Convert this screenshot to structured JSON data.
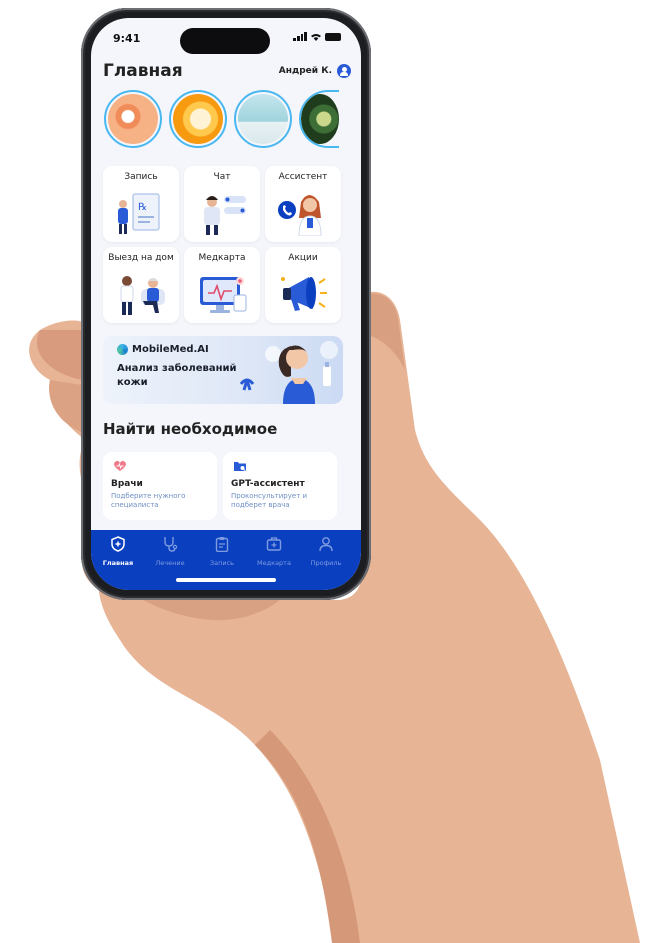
{
  "status": {
    "time": "9:41"
  },
  "header": {
    "title": "Главная",
    "user_name": "Андрей К."
  },
  "stories": [
    {
      "name": "pills-story",
      "color": "#f6a36b"
    },
    {
      "name": "orange-story",
      "color": "#f8a81e"
    },
    {
      "name": "bottles-story",
      "color": "#9fd3dc"
    },
    {
      "name": "capsules-story",
      "color": "#3a6a3a"
    }
  ],
  "tiles": [
    {
      "label": "Запись",
      "icon": "prescription-icon"
    },
    {
      "label": "Чат",
      "icon": "chat-icon"
    },
    {
      "label": "Ассистент",
      "icon": "assistant-icon"
    },
    {
      "label": "Выезд на дом",
      "icon": "home-visit-icon"
    },
    {
      "label": "Медкарта",
      "icon": "medcard-icon"
    },
    {
      "label": "Акции",
      "icon": "megaphone-icon"
    }
  ],
  "banner": {
    "brand": "MobileMed.AI",
    "text": "Анализ заболеваний кожи"
  },
  "find": {
    "title": "Найти необходимое",
    "cards": [
      {
        "title": "Врачи",
        "subtitle": "Подберите нужного специалиста",
        "icon": "heart-icon"
      },
      {
        "title": "GPT-ассистент",
        "subtitle": "Проконсультирует и подберет врача",
        "icon": "folder-icon"
      }
    ]
  },
  "tabbar": {
    "items": [
      {
        "label": "Главная",
        "icon": "shield-plus-icon",
        "active": true
      },
      {
        "label": "Лечение",
        "icon": "stethoscope-icon",
        "active": false
      },
      {
        "label": "Запись",
        "icon": "clipboard-icon",
        "active": false
      },
      {
        "label": "Медкарта",
        "icon": "medkit-icon",
        "active": false
      },
      {
        "label": "Профиль",
        "icon": "user-icon",
        "active": false
      }
    ]
  },
  "colors": {
    "accent": "#0a3fc0",
    "background": "#f4f6fb",
    "skin": "#e7b596"
  }
}
